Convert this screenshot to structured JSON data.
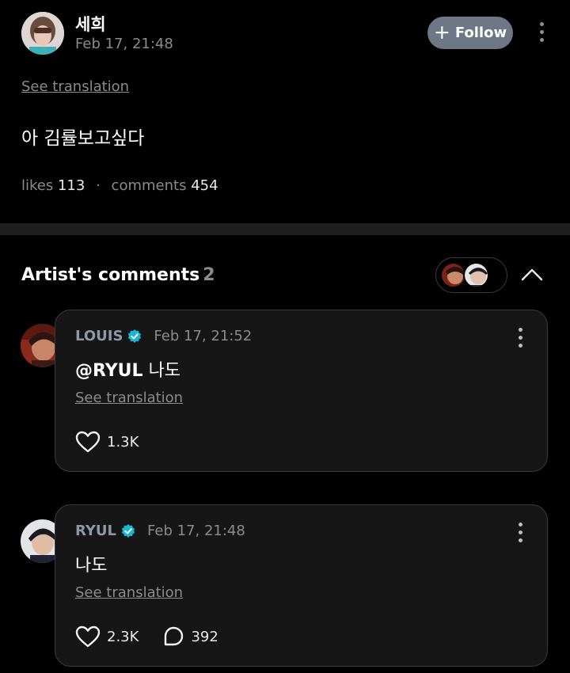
{
  "post": {
    "author": "세희",
    "date": "Feb 17, 21:48",
    "follow_label": "Follow",
    "see_translation": "See translation",
    "body": "아 김률보고싶다",
    "likes_label": "likes",
    "likes_count": "113",
    "comments_label": "comments",
    "comments_count": "454",
    "separator": "·"
  },
  "artist_comments": {
    "title": "Artist's comments",
    "count": "2"
  },
  "comments": [
    {
      "author": "LOUIS",
      "date": "Feb 17, 21:52",
      "mention": "@RYUL",
      "text": "나도",
      "see_translation": "See translation",
      "likes": "1.3K"
    },
    {
      "author": "RYUL",
      "date": "Feb 17, 21:48",
      "text": "나도",
      "see_translation": "See translation",
      "likes": "2.3K",
      "replies": "392"
    }
  ],
  "icons": {
    "verified": "verified-badge-icon",
    "heart": "heart-outline-icon",
    "reply": "speech-bubble-icon",
    "more": "vertical-dots-icon",
    "collapse": "chevron-up-icon",
    "plus": "plus-icon"
  },
  "colors": {
    "background": "#000000",
    "card_bg": "#161616",
    "card_border": "#3b3b3b",
    "follow_button": "#6e7785",
    "artist_name": "#8d98a8",
    "verified": "#1bb5d6",
    "muted_text": "#8b8b8b"
  }
}
